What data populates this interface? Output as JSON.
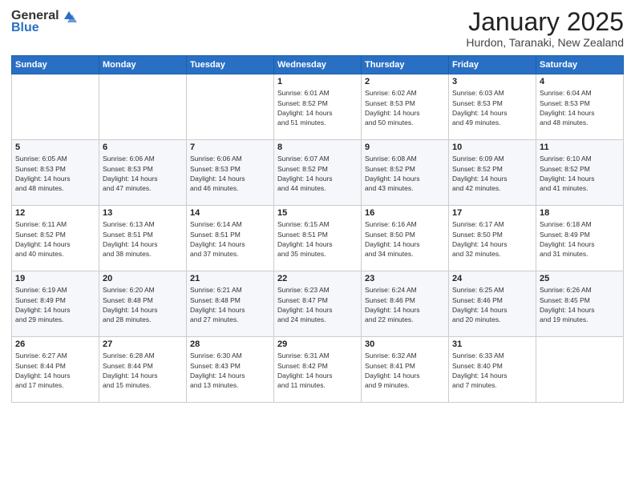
{
  "header": {
    "logo_general": "General",
    "logo_blue": "Blue",
    "month": "January 2025",
    "location": "Hurdon, Taranaki, New Zealand"
  },
  "days_of_week": [
    "Sunday",
    "Monday",
    "Tuesday",
    "Wednesday",
    "Thursday",
    "Friday",
    "Saturday"
  ],
  "weeks": [
    [
      {
        "day": "",
        "info": ""
      },
      {
        "day": "",
        "info": ""
      },
      {
        "day": "",
        "info": ""
      },
      {
        "day": "1",
        "info": "Sunrise: 6:01 AM\nSunset: 8:52 PM\nDaylight: 14 hours\nand 51 minutes."
      },
      {
        "day": "2",
        "info": "Sunrise: 6:02 AM\nSunset: 8:53 PM\nDaylight: 14 hours\nand 50 minutes."
      },
      {
        "day": "3",
        "info": "Sunrise: 6:03 AM\nSunset: 8:53 PM\nDaylight: 14 hours\nand 49 minutes."
      },
      {
        "day": "4",
        "info": "Sunrise: 6:04 AM\nSunset: 8:53 PM\nDaylight: 14 hours\nand 48 minutes."
      }
    ],
    [
      {
        "day": "5",
        "info": "Sunrise: 6:05 AM\nSunset: 8:53 PM\nDaylight: 14 hours\nand 48 minutes."
      },
      {
        "day": "6",
        "info": "Sunrise: 6:06 AM\nSunset: 8:53 PM\nDaylight: 14 hours\nand 47 minutes."
      },
      {
        "day": "7",
        "info": "Sunrise: 6:06 AM\nSunset: 8:53 PM\nDaylight: 14 hours\nand 46 minutes."
      },
      {
        "day": "8",
        "info": "Sunrise: 6:07 AM\nSunset: 8:52 PM\nDaylight: 14 hours\nand 44 minutes."
      },
      {
        "day": "9",
        "info": "Sunrise: 6:08 AM\nSunset: 8:52 PM\nDaylight: 14 hours\nand 43 minutes."
      },
      {
        "day": "10",
        "info": "Sunrise: 6:09 AM\nSunset: 8:52 PM\nDaylight: 14 hours\nand 42 minutes."
      },
      {
        "day": "11",
        "info": "Sunrise: 6:10 AM\nSunset: 8:52 PM\nDaylight: 14 hours\nand 41 minutes."
      }
    ],
    [
      {
        "day": "12",
        "info": "Sunrise: 6:11 AM\nSunset: 8:52 PM\nDaylight: 14 hours\nand 40 minutes."
      },
      {
        "day": "13",
        "info": "Sunrise: 6:13 AM\nSunset: 8:51 PM\nDaylight: 14 hours\nand 38 minutes."
      },
      {
        "day": "14",
        "info": "Sunrise: 6:14 AM\nSunset: 8:51 PM\nDaylight: 14 hours\nand 37 minutes."
      },
      {
        "day": "15",
        "info": "Sunrise: 6:15 AM\nSunset: 8:51 PM\nDaylight: 14 hours\nand 35 minutes."
      },
      {
        "day": "16",
        "info": "Sunrise: 6:16 AM\nSunset: 8:50 PM\nDaylight: 14 hours\nand 34 minutes."
      },
      {
        "day": "17",
        "info": "Sunrise: 6:17 AM\nSunset: 8:50 PM\nDaylight: 14 hours\nand 32 minutes."
      },
      {
        "day": "18",
        "info": "Sunrise: 6:18 AM\nSunset: 8:49 PM\nDaylight: 14 hours\nand 31 minutes."
      }
    ],
    [
      {
        "day": "19",
        "info": "Sunrise: 6:19 AM\nSunset: 8:49 PM\nDaylight: 14 hours\nand 29 minutes."
      },
      {
        "day": "20",
        "info": "Sunrise: 6:20 AM\nSunset: 8:48 PM\nDaylight: 14 hours\nand 28 minutes."
      },
      {
        "day": "21",
        "info": "Sunrise: 6:21 AM\nSunset: 8:48 PM\nDaylight: 14 hours\nand 27 minutes."
      },
      {
        "day": "22",
        "info": "Sunrise: 6:23 AM\nSunset: 8:47 PM\nDaylight: 14 hours\nand 24 minutes."
      },
      {
        "day": "23",
        "info": "Sunrise: 6:24 AM\nSunset: 8:46 PM\nDaylight: 14 hours\nand 22 minutes."
      },
      {
        "day": "24",
        "info": "Sunrise: 6:25 AM\nSunset: 8:46 PM\nDaylight: 14 hours\nand 20 minutes."
      },
      {
        "day": "25",
        "info": "Sunrise: 6:26 AM\nSunset: 8:45 PM\nDaylight: 14 hours\nand 19 minutes."
      }
    ],
    [
      {
        "day": "26",
        "info": "Sunrise: 6:27 AM\nSunset: 8:44 PM\nDaylight: 14 hours\nand 17 minutes."
      },
      {
        "day": "27",
        "info": "Sunrise: 6:28 AM\nSunset: 8:44 PM\nDaylight: 14 hours\nand 15 minutes."
      },
      {
        "day": "28",
        "info": "Sunrise: 6:30 AM\nSunset: 8:43 PM\nDaylight: 14 hours\nand 13 minutes."
      },
      {
        "day": "29",
        "info": "Sunrise: 6:31 AM\nSunset: 8:42 PM\nDaylight: 14 hours\nand 11 minutes."
      },
      {
        "day": "30",
        "info": "Sunrise: 6:32 AM\nSunset: 8:41 PM\nDaylight: 14 hours\nand 9 minutes."
      },
      {
        "day": "31",
        "info": "Sunrise: 6:33 AM\nSunset: 8:40 PM\nDaylight: 14 hours\nand 7 minutes."
      },
      {
        "day": "",
        "info": ""
      }
    ]
  ]
}
